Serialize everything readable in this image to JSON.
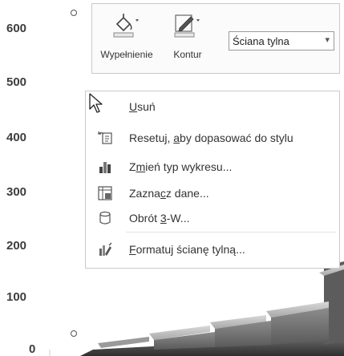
{
  "chart": {
    "y_ticks": [
      "600",
      "500",
      "400",
      "300",
      "200",
      "100",
      "0"
    ]
  },
  "mini_toolbar": {
    "fill_label": "Wypełnienie",
    "outline_label": "Kontur",
    "element_selector": {
      "value": "Ściana tylna"
    },
    "icons": [
      "paint-bucket-icon",
      "pen-outline-icon"
    ]
  },
  "context_menu": {
    "items": [
      {
        "pre": "",
        "accel": "U",
        "post": "suń",
        "icon": "none"
      },
      {
        "pre": "Resetuj, ",
        "accel": "a",
        "post": "by dopasować do stylu",
        "icon": "reset-style-icon"
      },
      {
        "pre": "Z",
        "accel": "m",
        "post": "ień typ wykresu...",
        "icon": "bar-chart-icon"
      },
      {
        "pre": "Zazna",
        "accel": "c",
        "post": "z dane...",
        "icon": "select-data-icon"
      },
      {
        "pre": "Obrót ",
        "accel": "3",
        "post": "-W...",
        "icon": "rotate-3d-icon"
      },
      {
        "pre": "",
        "accel": "F",
        "post": "ormatuj ścianę tylną...",
        "icon": "format-wall-icon"
      }
    ]
  },
  "colors": {
    "menu_border": "#c9c9c9",
    "text": "#333333",
    "axis_text": "#3d3d3d"
  }
}
